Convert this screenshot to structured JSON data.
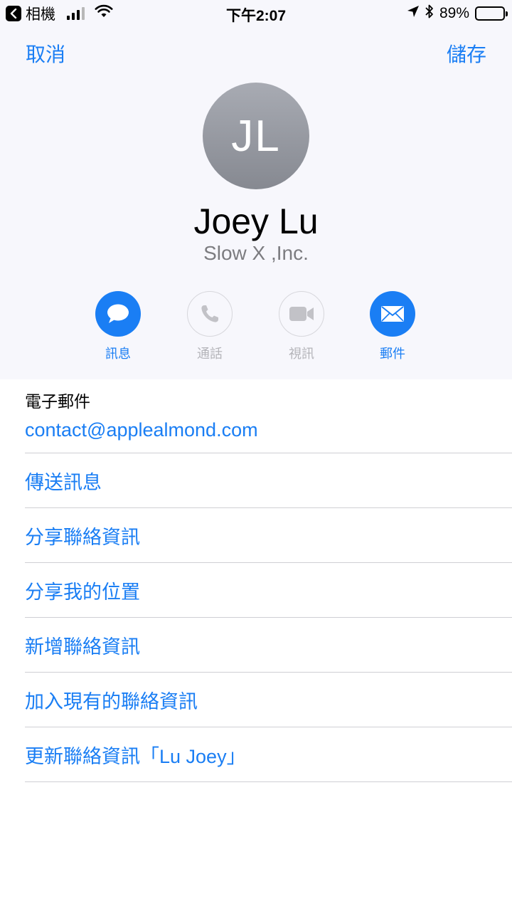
{
  "status_bar": {
    "back_app": "相機",
    "time": "下午2:07",
    "battery": "89%",
    "battery_level": 0.89
  },
  "nav": {
    "cancel": "取消",
    "save": "儲存"
  },
  "contact": {
    "initials": "JL",
    "name": "Joey Lu",
    "company": "Slow X ,Inc."
  },
  "actions": [
    {
      "label": "訊息",
      "icon": "message-bubble-icon",
      "active": true
    },
    {
      "label": "通話",
      "icon": "phone-icon",
      "active": false
    },
    {
      "label": "視訊",
      "icon": "video-camera-icon",
      "active": false
    },
    {
      "label": "郵件",
      "icon": "envelope-icon",
      "active": true
    }
  ],
  "email": {
    "label": "電子郵件",
    "value": "contact@applealmond.com"
  },
  "list": [
    "傳送訊息",
    "分享聯絡資訊",
    "分享我的位置",
    "新增聯絡資訊",
    "加入現有的聯絡資訊",
    "更新聯絡資訊「Lu Joey」"
  ],
  "colors": {
    "accent": "#1a7ef4",
    "header_bg": "#f7f7fc",
    "secondary_text": "#7c7c80",
    "disabled": "#b4b4b9"
  }
}
